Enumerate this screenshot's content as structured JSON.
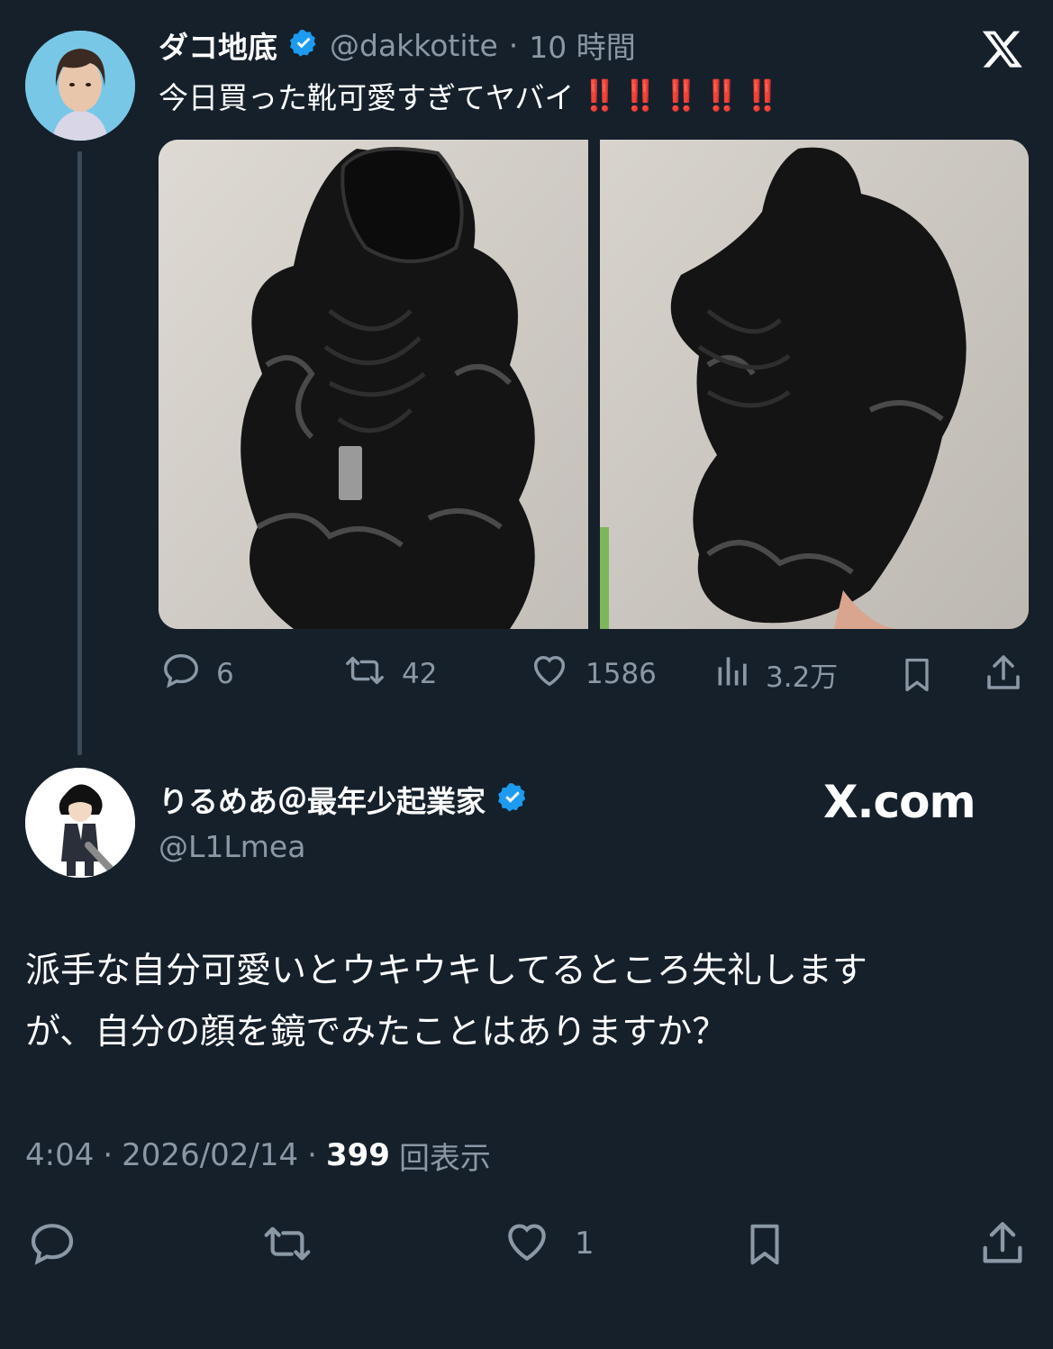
{
  "original_tweet": {
    "author_name": "ダコ地底",
    "handle": "@dakkotite",
    "separator": "·",
    "time": "10 時間",
    "text": "今日買った靴可愛すぎてヤバイ",
    "emphasis": "‼️‼️‼️‼️‼️",
    "counts": {
      "replies": "6",
      "retweets": "42",
      "likes": "1586",
      "views": "3.2万"
    }
  },
  "reply": {
    "author_name": "りるめあ＠最年少起業家",
    "handle": "@L1Lmea",
    "watermark": "X.com",
    "text_line1": "派手な自分可愛いとウキウキしてるところ失礼します",
    "text_line2": "が、自分の顔を鏡でみたことはありますか？",
    "time": "4:04",
    "date": "2026/02/14",
    "separator": "·",
    "view_count": "399",
    "view_label": "回表示",
    "like_count": "1"
  },
  "colors": {
    "background": "#15202b",
    "verified": "#1d9bf0",
    "muted": "#8b98a5",
    "emphasis": "#e0141e"
  },
  "icons": [
    "x-logo-icon",
    "verified-badge-icon",
    "reply-icon",
    "retweet-icon",
    "like-icon",
    "views-icon",
    "bookmark-icon",
    "share-icon"
  ]
}
